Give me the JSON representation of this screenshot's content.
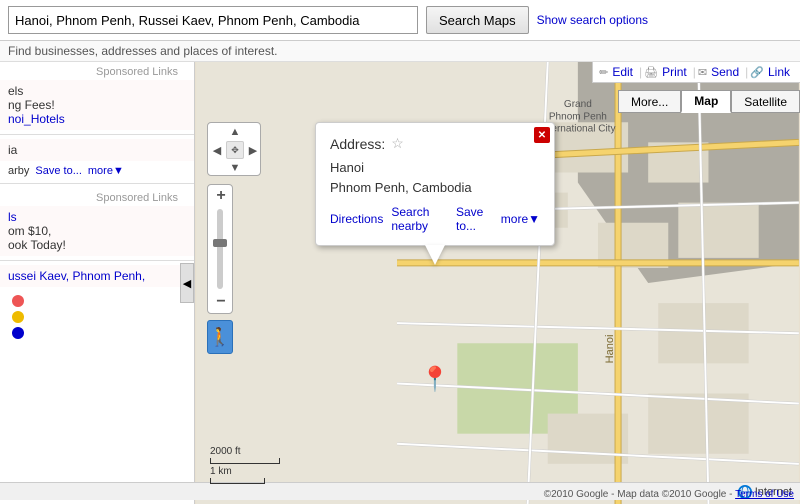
{
  "header": {
    "search_value": "Hanoi, Phnom Penh, Russei Kaev, Phnom Penh, Cambodia",
    "search_placeholder": "Search Maps",
    "search_button_label": "Search Maps",
    "show_options_label": "Show search options",
    "subbar_text": "Find businesses, addresses and places of interest."
  },
  "toolbar": {
    "edit_label": "Edit",
    "print_label": "Print",
    "send_label": "Send",
    "link_label": "Link"
  },
  "map_view_buttons": {
    "more_label": "More...",
    "map_label": "Map",
    "satellite_label": "Satellite"
  },
  "sidebar": {
    "collapse_icon": "◀",
    "sponsored1_label": "Sponsored Links",
    "sponsored2_label": "Sponsored Links",
    "ad1_title": "els",
    "ad1_line1": "ng Fees!",
    "ad1_link": "noi_Hotels",
    "ad2_prefix": "ia",
    "ad2_line1": "arby",
    "ad2_save": "Save to...",
    "ad2_more": "more▼",
    "ad3_title": "ls",
    "ad3_line1": "om $10,",
    "ad3_line2": "ook Today!",
    "ad4_line1": "ussei Kaev, Phnom Penh,"
  },
  "info_bubble": {
    "title": "Address:",
    "star_char": "☆",
    "line1": "Hanoi",
    "line2": "Phnom Penh, Cambodia",
    "directions_label": "Directions",
    "search_nearby_label": "Search nearby",
    "save_to_label": "Save to...",
    "more_label": "more▼",
    "close_char": "✕"
  },
  "map_scale": {
    "ft_label": "2000 ft",
    "km_label": "1 km"
  },
  "map_copyright": {
    "text": "©2010 Google - Map data ©2010 Google -",
    "terms_label": "Terms of Use"
  },
  "status_bar": {
    "label": "Internet"
  },
  "nav_control": {
    "up": "▲",
    "down": "▼",
    "left": "◀",
    "right": "▶",
    "center": "✥"
  },
  "zoom_control": {
    "plus": "+",
    "minus": "−"
  }
}
